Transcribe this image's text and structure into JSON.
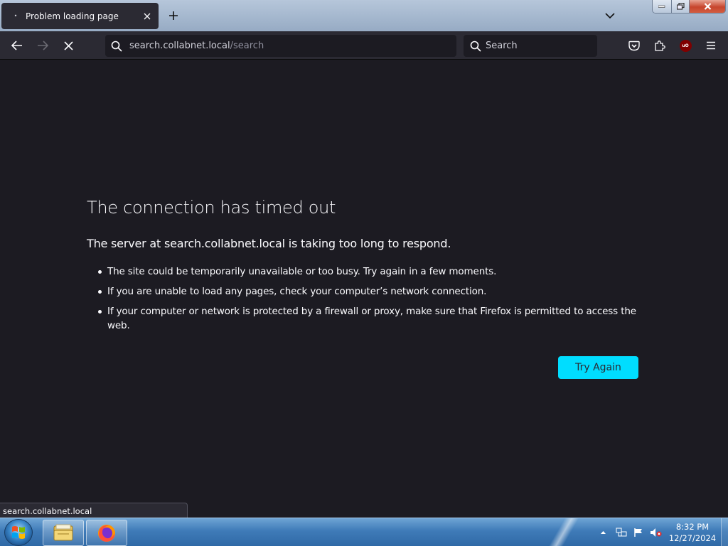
{
  "browser": {
    "tab": {
      "title": "Problem loading page"
    },
    "url": {
      "host": "search.collabnet.local",
      "path": "/search"
    },
    "search": {
      "placeholder": "Search"
    },
    "ublock_badge": "uO"
  },
  "error_page": {
    "title": "The connection has timed out",
    "description": "The server at search.collabnet.local is taking too long to respond.",
    "suggestions": [
      "The site could be temporarily unavailable or too busy. Try again in a few moments.",
      "If you are unable to load any pages, check your computer’s network connection.",
      "If your computer or network is protected by a firewall or proxy, make sure that Firefox is permitted to access the web."
    ],
    "try_again_label": "Try Again"
  },
  "status_panel": {
    "text": "search.collabnet.local"
  },
  "taskbar": {
    "time": "8:32 PM",
    "date": "12/27/2024",
    "pinned": [
      "windows-explorer",
      "firefox"
    ]
  },
  "colors": {
    "page_bg": "#1c1b22",
    "toolbar_bg": "#2b2a33",
    "accent_button": "#00ddff",
    "text": "#fbfbfe"
  }
}
